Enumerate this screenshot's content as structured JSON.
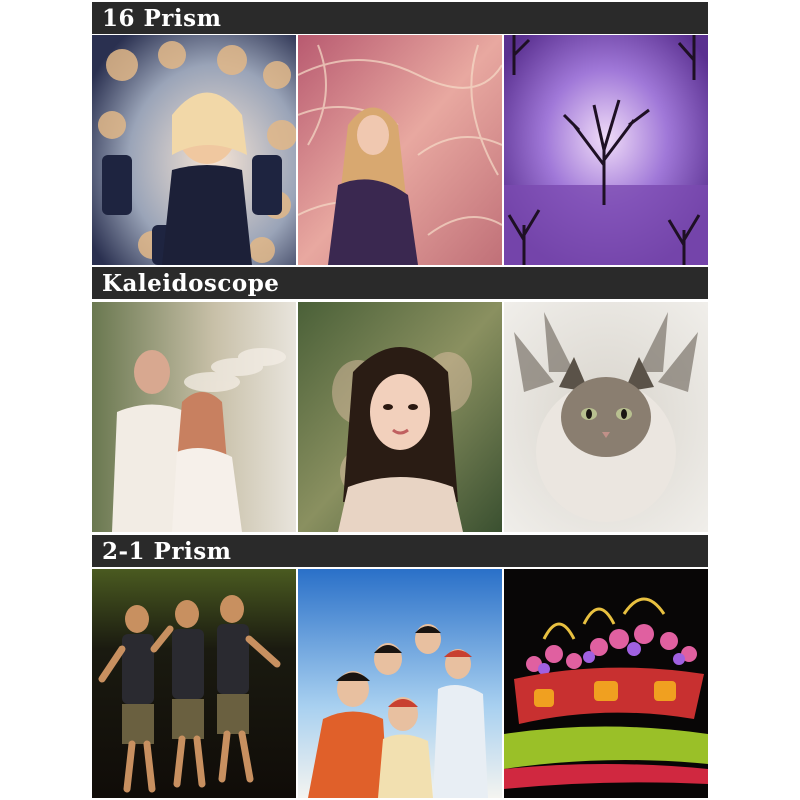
{
  "sections": [
    {
      "title": "16 Prism",
      "photos": [
        {
          "subject": "blonde woman in dark top repeated many times",
          "colors": [
            "#e8c8a8",
            "#2a3050",
            "#f5e0d0"
          ]
        },
        {
          "subject": "woman with long hair in purple dress on pink background",
          "colors": [
            "#d07080",
            "#4a3060",
            "#f0d0c8"
          ]
        },
        {
          "subject": "tree on lake at dusk in purple tones",
          "colors": [
            "#8a60c0",
            "#2a1838",
            "#e8d0f0"
          ]
        }
      ]
    },
    {
      "title": "Kaleidoscope",
      "photos": [
        {
          "subject": "couple in white outfits with hats",
          "colors": [
            "#7a8a60",
            "#f0e8e0",
            "#c8a088"
          ]
        },
        {
          "subject": "young woman with long hair outdoors",
          "colors": [
            "#5a7040",
            "#e8c0a8",
            "#2a2018"
          ]
        },
        {
          "subject": "fluffy grey and white kitten",
          "colors": [
            "#8a8070",
            "#e8e4e0",
            "#4a4238"
          ]
        }
      ]
    },
    {
      "title": "2-1 Prism",
      "photos": [
        {
          "subject": "dancers in basketball jerseys on stage",
          "colors": [
            "#1a1a10",
            "#b08040",
            "#3a4a20"
          ]
        },
        {
          "subject": "group of young people under blue sky",
          "colors": [
            "#4a90d0",
            "#e06030",
            "#f0f4f8"
          ]
        },
        {
          "subject": "lantern flower basket display at night",
          "colors": [
            "#0a0808",
            "#d02030",
            "#a0c020"
          ]
        }
      ]
    }
  ]
}
